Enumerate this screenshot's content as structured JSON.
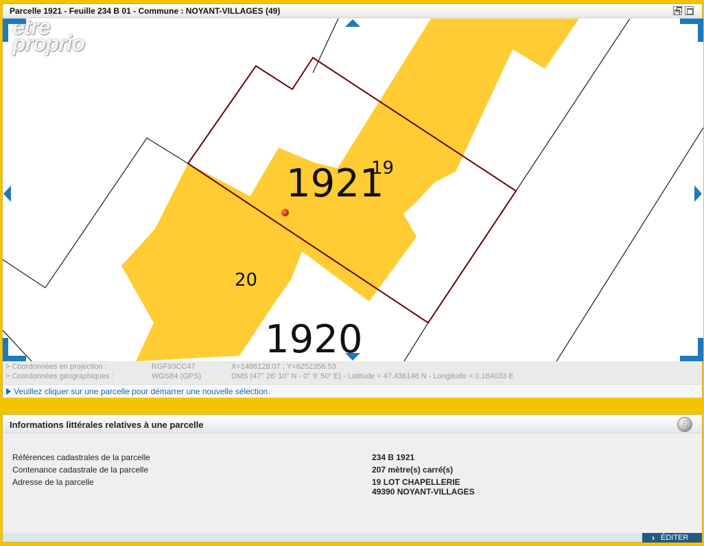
{
  "map_window": {
    "title": "Parcelle 1921 - Feuille 234 B 01 - Commune : NOYANT-VILLAGES (49)",
    "watermark": [
      "être",
      "proprio"
    ],
    "parcel_labels": {
      "main": "1921",
      "street_number": "19",
      "neighbor_left": "20",
      "neighbor_bottom": "1920"
    },
    "icons": {
      "restore": "restore-window-icon",
      "maximize": "maximize-window-icon",
      "pan_up": "arrow-up-icon",
      "pan_down": "arrow-down-icon",
      "pan_left": "arrow-left-icon",
      "pan_right": "arrow-right-icon",
      "marker": "location-marker-icon"
    },
    "colors": {
      "building": "#ffcc33",
      "selected_outline": "#6b0000",
      "parcel_outline": "#2a2a2a",
      "nav": "#1e7ab8"
    }
  },
  "coordinates": {
    "projection": {
      "label": "> Coordonnées en projection :",
      "system": "RGF93CC47",
      "value": "X=1486128.07 ; Y=6252356.53"
    },
    "geographic": {
      "label": "> Coordonnées géographiques :",
      "system": "WGS84 (GPS)",
      "value": "DMS (47° 26' 10\" N - 0° 9' 50\" E) - Latitude = 47.436146 N - Longitude = 0.164033 E"
    }
  },
  "hint": "Veuillez cliquer sur une parcelle pour démarrer une nouvelle sélection.",
  "info_panel": {
    "title": "Informations littérales relatives à une parcelle",
    "help": "?",
    "rows": {
      "references": {
        "label": "Références cadastrales de la parcelle",
        "value": "234 B 1921"
      },
      "contenance": {
        "label": "Contenance cadastrale de la parcelle",
        "value": "207 mètre(s) carré(s)"
      },
      "adresse": {
        "label": "Adresse de la parcelle",
        "value_line1": "19 LOT CHAPELLERIE",
        "value_line2": "49390 NOYANT-VILLAGES"
      }
    },
    "edit_button": "ÉDITER"
  }
}
